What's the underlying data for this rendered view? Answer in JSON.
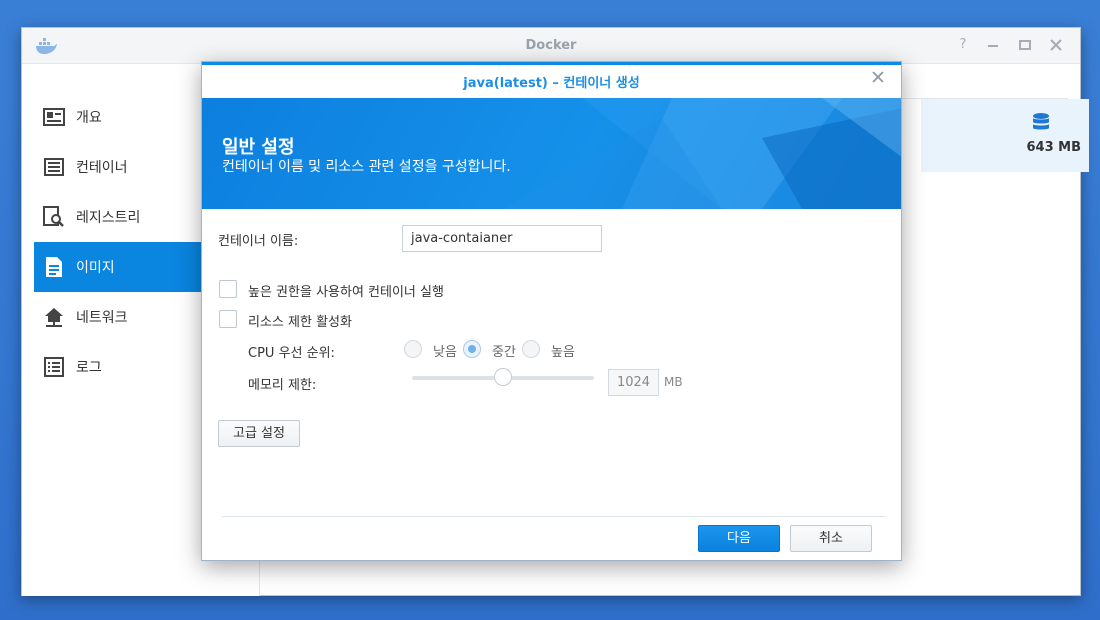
{
  "app": {
    "title": "Docker",
    "controls": [
      "help-icon",
      "minimize-icon",
      "maximize-icon",
      "close-icon"
    ]
  },
  "sidebar": {
    "items": [
      {
        "label": "개요",
        "icon": "overview-card-icon",
        "active": false
      },
      {
        "label": "컨테이너",
        "icon": "container-list-icon",
        "active": false
      },
      {
        "label": "레지스트리",
        "icon": "registry-search-icon",
        "active": false
      },
      {
        "label": "이미지",
        "icon": "image-document-icon",
        "active": true
      },
      {
        "label": "네트워크",
        "icon": "network-house-icon",
        "active": false
      },
      {
        "label": "로그",
        "icon": "log-list-icon",
        "active": false
      }
    ]
  },
  "main": {
    "row_size": "643 MB",
    "size_icon": "database-icon"
  },
  "dialog": {
    "title": "java(latest) – 컨테이너 생성",
    "banner_title": "일반 설정",
    "banner_subtitle": "컨테이너 이름 및 리소스 관련 설정을 구성합니다.",
    "container_name_label": "컨테이너 이름:",
    "container_name_value": "java-contaianer",
    "privileged_label": "높은 권한을 사용하여 컨테이너 실행",
    "resource_limit_label": "리소스 제한 활성화",
    "cpu_priority_label": "CPU 우선 순위:",
    "cpu_options": [
      {
        "label": "낮음",
        "selected": false
      },
      {
        "label": "중간",
        "selected": true
      },
      {
        "label": "높음",
        "selected": false
      }
    ],
    "memory_limit_label": "메모리 제한:",
    "memory_value": "1024",
    "memory_unit": "MB",
    "memory_slider_fraction": 0.5,
    "advanced_button": "고급 설정",
    "next_button": "다음",
    "cancel_button": "취소"
  },
  "colors": {
    "accent": "#0a85e0",
    "desktop": "#3a7fd6"
  }
}
